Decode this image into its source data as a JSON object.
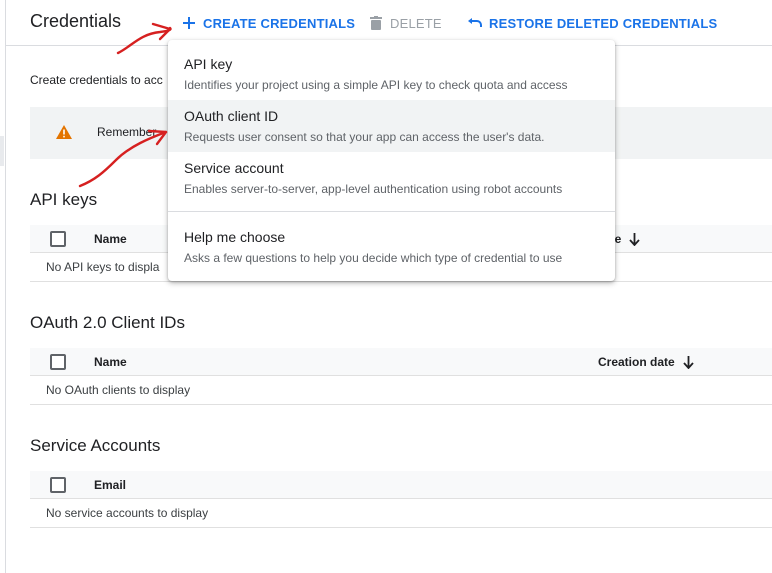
{
  "header": {
    "title": "Credentials",
    "create_label": "CREATE CREDENTIALS",
    "delete_label": "DELETE",
    "restore_label": "RESTORE DELETED CREDENTIALS"
  },
  "intro_text": "Create credentials to acc",
  "banner": {
    "text": "Remember"
  },
  "api_keys": {
    "title": "API keys",
    "col_name": "Name",
    "col_date": "n date",
    "empty": "No API keys to displa"
  },
  "oauth": {
    "title": "OAuth 2.0 Client IDs",
    "col_name": "Name",
    "col_date": "Creation date",
    "empty": "No OAuth clients to display"
  },
  "service_accounts": {
    "title": "Service Accounts",
    "col_name": "Email",
    "empty": "No service accounts to display"
  },
  "menu": {
    "items": [
      {
        "label": "API key",
        "desc": "Identifies your project using a simple API key to check quota and access"
      },
      {
        "label": "OAuth client ID",
        "desc": "Requests user consent so that your app can access the user's data."
      },
      {
        "label": "Service account",
        "desc": "Enables server-to-server, app-level authentication using robot accounts"
      },
      {
        "label": "Help me choose",
        "desc": "Asks a few questions to help you decide which type of credential to use"
      }
    ],
    "highlighted_index": 1
  },
  "icons": {
    "create": "plus-icon",
    "delete": "trash-icon",
    "restore": "undo-icon",
    "warning": "warning-icon",
    "sort": "arrow-down-icon"
  },
  "colors": {
    "accent": "#1a73e8",
    "disabled": "#9aa0a6",
    "warning": "#e37400",
    "annotation": "#d62020"
  }
}
